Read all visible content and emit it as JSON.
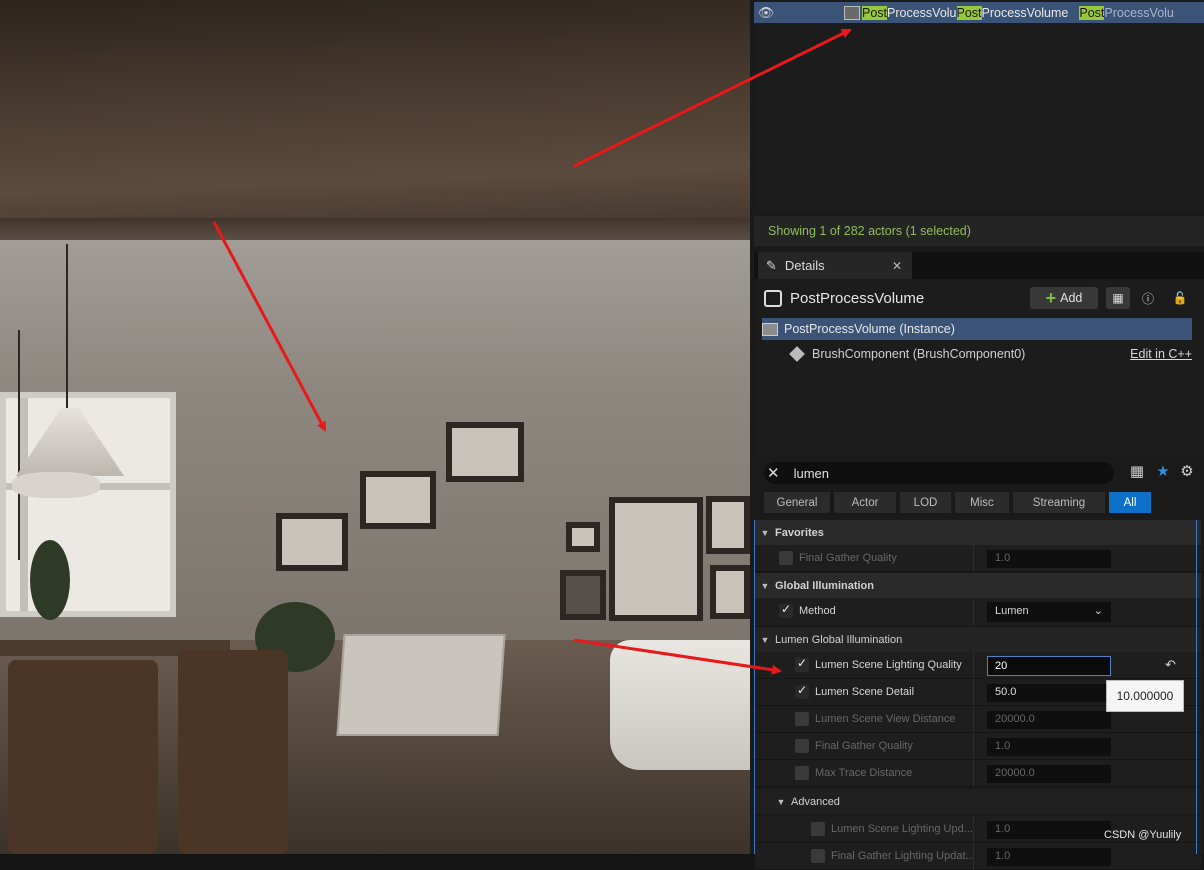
{
  "outliner": {
    "rows": [
      {
        "match": "Post",
        "rest": "ProcessVolu"
      },
      {
        "match": "Post",
        "rest": "ProcessVolume"
      },
      {
        "match": "Post",
        "rest": "ProcessVolu"
      }
    ],
    "status": "Showing 1 of 282 actors (1 selected)"
  },
  "details": {
    "tab_label": "Details",
    "actor_name": "PostProcessVolume",
    "add_label": "Add",
    "components": [
      {
        "label": "PostProcessVolume (Instance)"
      },
      {
        "label": "BrushComponent (BrushComponent0)",
        "link": "Edit in C++"
      }
    ],
    "search_value": "lumen",
    "filters": [
      "General",
      "Actor",
      "LOD",
      "Misc",
      "Streaming",
      "All"
    ],
    "active_filter": "All"
  },
  "properties": {
    "favorites": {
      "label": "Favorites",
      "final_gather_quality": {
        "label": "Final Gather Quality",
        "value": "1.0"
      }
    },
    "global_illumination": {
      "label": "Global Illumination",
      "method": {
        "label": "Method",
        "value": "Lumen"
      }
    },
    "lumen_gi": {
      "label": "Lumen Global Illumination",
      "scene_lighting_quality": {
        "label": "Lumen Scene Lighting Quality",
        "value": "20"
      },
      "scene_detail": {
        "label": "Lumen Scene Detail",
        "value": "50.0"
      },
      "scene_view_distance": {
        "label": "Lumen Scene View Distance",
        "value": "20000.0"
      },
      "final_gather_quality": {
        "label": "Final Gather Quality",
        "value": "1.0"
      },
      "max_trace_distance": {
        "label": "Max Trace Distance",
        "value": "20000.0"
      }
    },
    "advanced": {
      "label": "Advanced",
      "scene_lighting_update": {
        "label": "Lumen Scene Lighting Upd...",
        "value": "1.0"
      },
      "final_gather_lighting": {
        "label": "Final Gather Lighting Updat...",
        "value": "1.0"
      }
    }
  },
  "tooltip": "10.000000",
  "watermark": "CSDN @Yuulily",
  "colors": {
    "selection": "#3c5378",
    "highlight": "#97c93a",
    "active_tab": "#0e70c9",
    "annotation_arrow": "#e8191a"
  }
}
